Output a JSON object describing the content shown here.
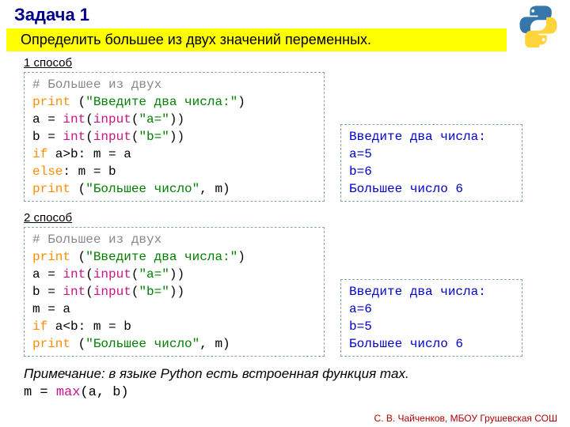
{
  "title": "Задача 1",
  "banner": "Определить большее из двух значений переменных.",
  "method1_label": "1 способ",
  "method2_label": "2 способ",
  "code1": {
    "c": "# Большее из двух",
    "p1a": "print",
    "p1b": " (",
    "p1c": "\"Введите два числа:\"",
    "p1d": ")",
    "l3a": "a = ",
    "l3b": "int",
    "l3c": "(",
    "l3d": "input",
    "l3e": "(",
    "l3f": "\"a=\"",
    "l3g": "))",
    "l4a": "b = ",
    "l4b": "int",
    "l4c": "(",
    "l4d": "input",
    "l4e": "(",
    "l4f": "\"b=\"",
    "l4g": "))",
    "l5a": "if",
    "l5b": " a>b: m = a",
    "l6a": "else",
    "l6b": ": m = b",
    "l7a": "print",
    "l7b": " (",
    "l7c": "\"Большее число\"",
    "l7d": ", m)"
  },
  "out1": {
    "l1": "Введите два числа:",
    "l2": "a=5",
    "l3": "b=6",
    "l4": "Большее число 6"
  },
  "code2": {
    "c": "# Большее из двух",
    "p1a": "print",
    "p1b": " (",
    "p1c": "\"Введите два числа:\"",
    "p1d": ")",
    "l3a": "a = ",
    "l3b": "int",
    "l3c": "(",
    "l3d": "input",
    "l3e": "(",
    "l3f": "\"a=\"",
    "l3g": "))",
    "l4a": "b = ",
    "l4b": "int",
    "l4c": "(",
    "l4d": "input",
    "l4e": "(",
    "l4f": "\"b=\"",
    "l4g": "))",
    "l5": "m = a",
    "l6a": "if",
    "l6b": " a<b: m = b",
    "l7a": "print",
    "l7b": " (",
    "l7c": "\"Большее число\"",
    "l7d": ", m)"
  },
  "out2": {
    "l1": "Введите два числа:",
    "l2": "a=6",
    "l3": "b=5",
    "l4": "Большее число 6"
  },
  "note": "Примечание: в языке Python есть встроенная функция max.",
  "maxline": {
    "a": "m = ",
    "b": "max",
    "c": "(a, b)"
  },
  "footer": "С. В. Чайченков, МБОУ Грушевская СОШ"
}
